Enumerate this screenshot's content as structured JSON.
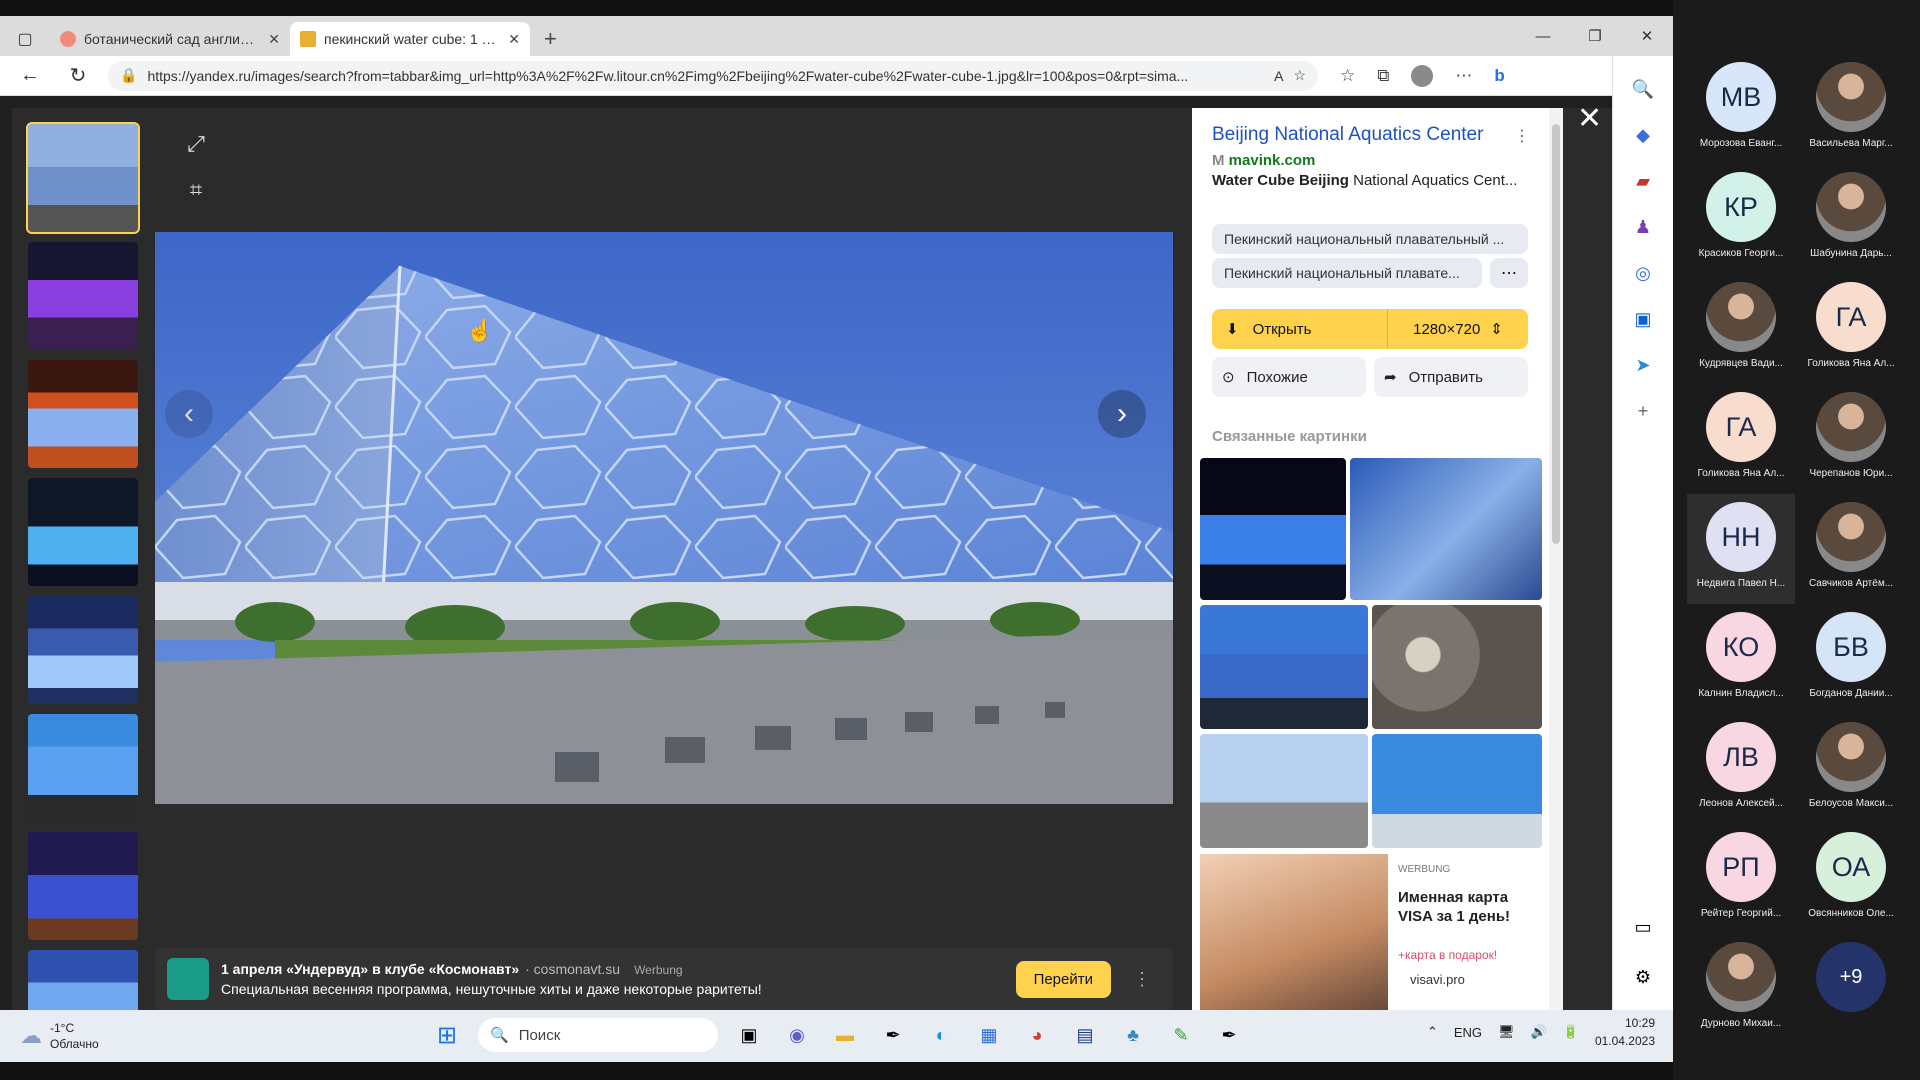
{
  "browser": {
    "tabs": [
      {
        "title": "ботанический сад англии - Ян",
        "active": false
      },
      {
        "title": "пекинский water cube: 1 тыс из",
        "active": true
      }
    ],
    "url": "https://yandex.ru/images/search?from=tabbar&img_url=http%3A%2F%2Fw.litour.cn%2Fimg%2Fbeijing%2Fwater-cube%2Fwater-cube-1.jpg&lr=100&pos=0&rpt=sima..."
  },
  "panel": {
    "title": "Beijing National Aquatics Center",
    "source": "mavink.com",
    "desc_bold": "Water Cube Beijing",
    "desc_rest": " National Aquatics Cent...",
    "chip1": "Пекинский национальный плавательный ...",
    "chip2": "Пекинский национальный плавате...",
    "open_label": "Открыть",
    "size_label": "1280×720",
    "similar_label": "Похожие",
    "send_label": "Отправить",
    "related_heading": "Связанные картинки",
    "adcard": {
      "werbung": "WERBUNG",
      "title": "Именная карта VISA за 1 день!",
      "promo": "+карта в подарок!",
      "site": "visavi.pro"
    }
  },
  "ad": {
    "title": "1 апреля «Ундервуд» в клубе «Космонавт»",
    "source": "· cosmonavt.su",
    "werbung": "Werbung",
    "text": "Специальная весенняя программа, нешуточные хиты и даже некоторые раритеты!",
    "button": "Перейти"
  },
  "taskbar": {
    "temp": "-1°C",
    "weather": "Облачно",
    "search": "Поиск",
    "lang": "ENG",
    "time": "10:29",
    "date": "01.04.2023"
  },
  "participants": [
    {
      "initials": "МВ",
      "name": "Морозова Еванг...",
      "color": "#d7e6f8"
    },
    {
      "initials": "",
      "name": "Васильева Марг...",
      "color": ""
    },
    {
      "initials": "КР",
      "name": "Красиков Георги...",
      "color": "#d2f1e9"
    },
    {
      "initials": "",
      "name": "Шабунина Дарь...",
      "color": ""
    },
    {
      "initials": "",
      "name": "Кудрявцев Вади...",
      "color": ""
    },
    {
      "initials": "ГА",
      "name": "Голикова Яна Ал...",
      "color": "#f8dccd"
    },
    {
      "initials": "ГА",
      "name": "Голикова Яна Ал...",
      "color": "#f8dccd"
    },
    {
      "initials": "",
      "name": "Черепанов Юри...",
      "color": ""
    },
    {
      "initials": "НН",
      "name": "Недвига Павел Н...",
      "color": "#dfe1f3"
    },
    {
      "initials": "",
      "name": "Савчиков Артём...",
      "color": ""
    },
    {
      "initials": "КО",
      "name": "Калнин Владисл...",
      "color": "#f8d6e2"
    },
    {
      "initials": "БВ",
      "name": "Богданов Дании...",
      "color": "#d5e4f6"
    },
    {
      "initials": "ЛВ",
      "name": "Леонов Алексей...",
      "color": "#f8d6e2"
    },
    {
      "initials": "",
      "name": "Белоусов Макси...",
      "color": ""
    },
    {
      "initials": "РП",
      "name": "Рейтер Георгий...",
      "color": "#f8d6e2"
    },
    {
      "initials": "ОА",
      "name": "Овсянников Оле...",
      "color": "#d6f0dc"
    },
    {
      "initials": "",
      "name": "Дурново Михаи...",
      "color": ""
    },
    {
      "initials": "+9",
      "name": "",
      "color": "#24346a"
    }
  ]
}
